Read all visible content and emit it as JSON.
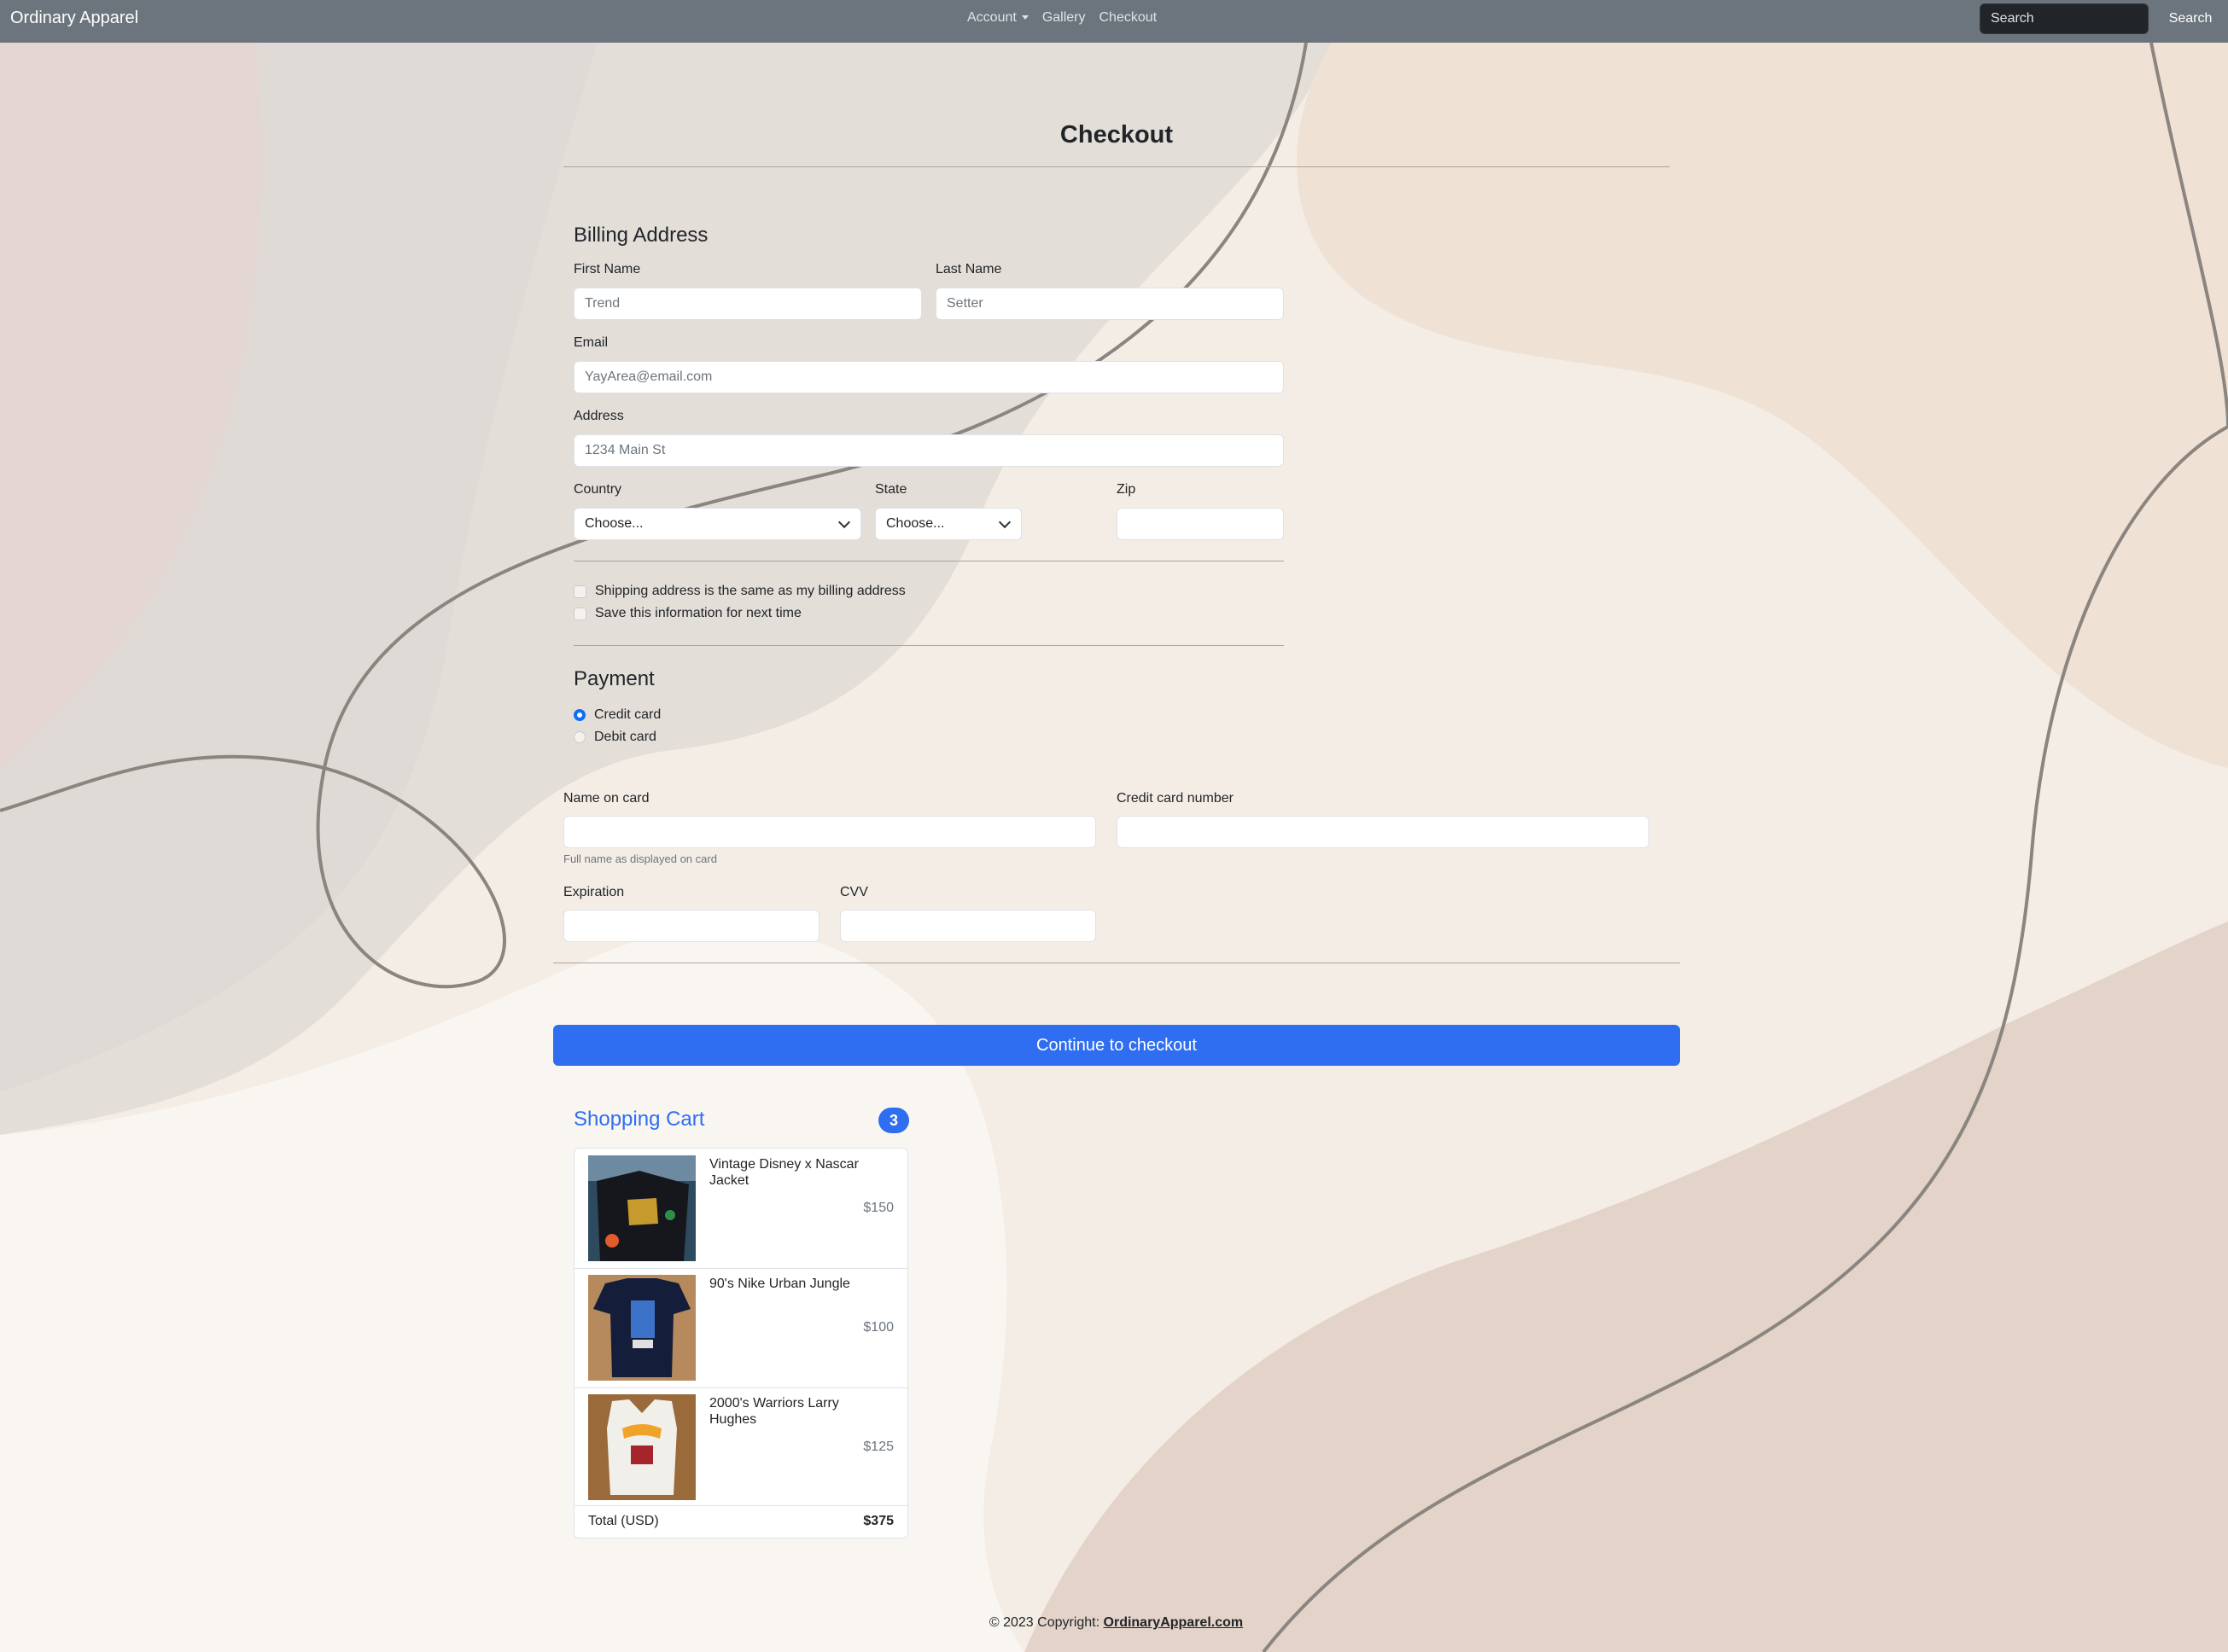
{
  "nav": {
    "brand": "Ordinary Apparel",
    "links": [
      "Account",
      "Gallery",
      "Checkout"
    ],
    "search_placeholder": "Search",
    "search_button": "Search"
  },
  "page": {
    "title": "Checkout"
  },
  "billing": {
    "heading": "Billing Address",
    "first_name": {
      "label": "First Name",
      "placeholder": "Trend"
    },
    "last_name": {
      "label": "Last Name",
      "placeholder": "Setter"
    },
    "email": {
      "label": "Email",
      "placeholder": "YayArea@email.com"
    },
    "address": {
      "label": "Address",
      "placeholder": "1234 Main St"
    },
    "country": {
      "label": "Country",
      "value": "Choose..."
    },
    "state": {
      "label": "State",
      "value": "Choose..."
    },
    "zip": {
      "label": "Zip",
      "value": ""
    },
    "checks": [
      "Shipping address is the same as my billing address",
      "Save this information for next time"
    ]
  },
  "payment": {
    "heading": "Payment",
    "methods": [
      {
        "label": "Credit card",
        "selected": true
      },
      {
        "label": "Debit card",
        "selected": false
      }
    ],
    "name_on_card": {
      "label": "Name on card",
      "help": "Full name as displayed on card"
    },
    "card_number": {
      "label": "Credit card number"
    },
    "expiration": {
      "label": "Expiration"
    },
    "cvv": {
      "label": "CVV"
    }
  },
  "checkout_button": "Continue to checkout",
  "cart": {
    "title": "Shopping Cart",
    "count": "3",
    "items": [
      {
        "name": "Vintage Disney x Nascar Jacket",
        "price": "$150"
      },
      {
        "name": "90's Nike Urban Jungle",
        "price": "$100"
      },
      {
        "name": "2000's Warriors Larry Hughes",
        "price": "$125"
      }
    ],
    "total_label": "Total (USD)",
    "total_value": "$375"
  },
  "footer": {
    "text": "© 2023 Copyright:",
    "link": "OrdinaryApparel.com"
  },
  "colors": {
    "primary": "#2f6ef1",
    "navbar": "#6c757d"
  }
}
